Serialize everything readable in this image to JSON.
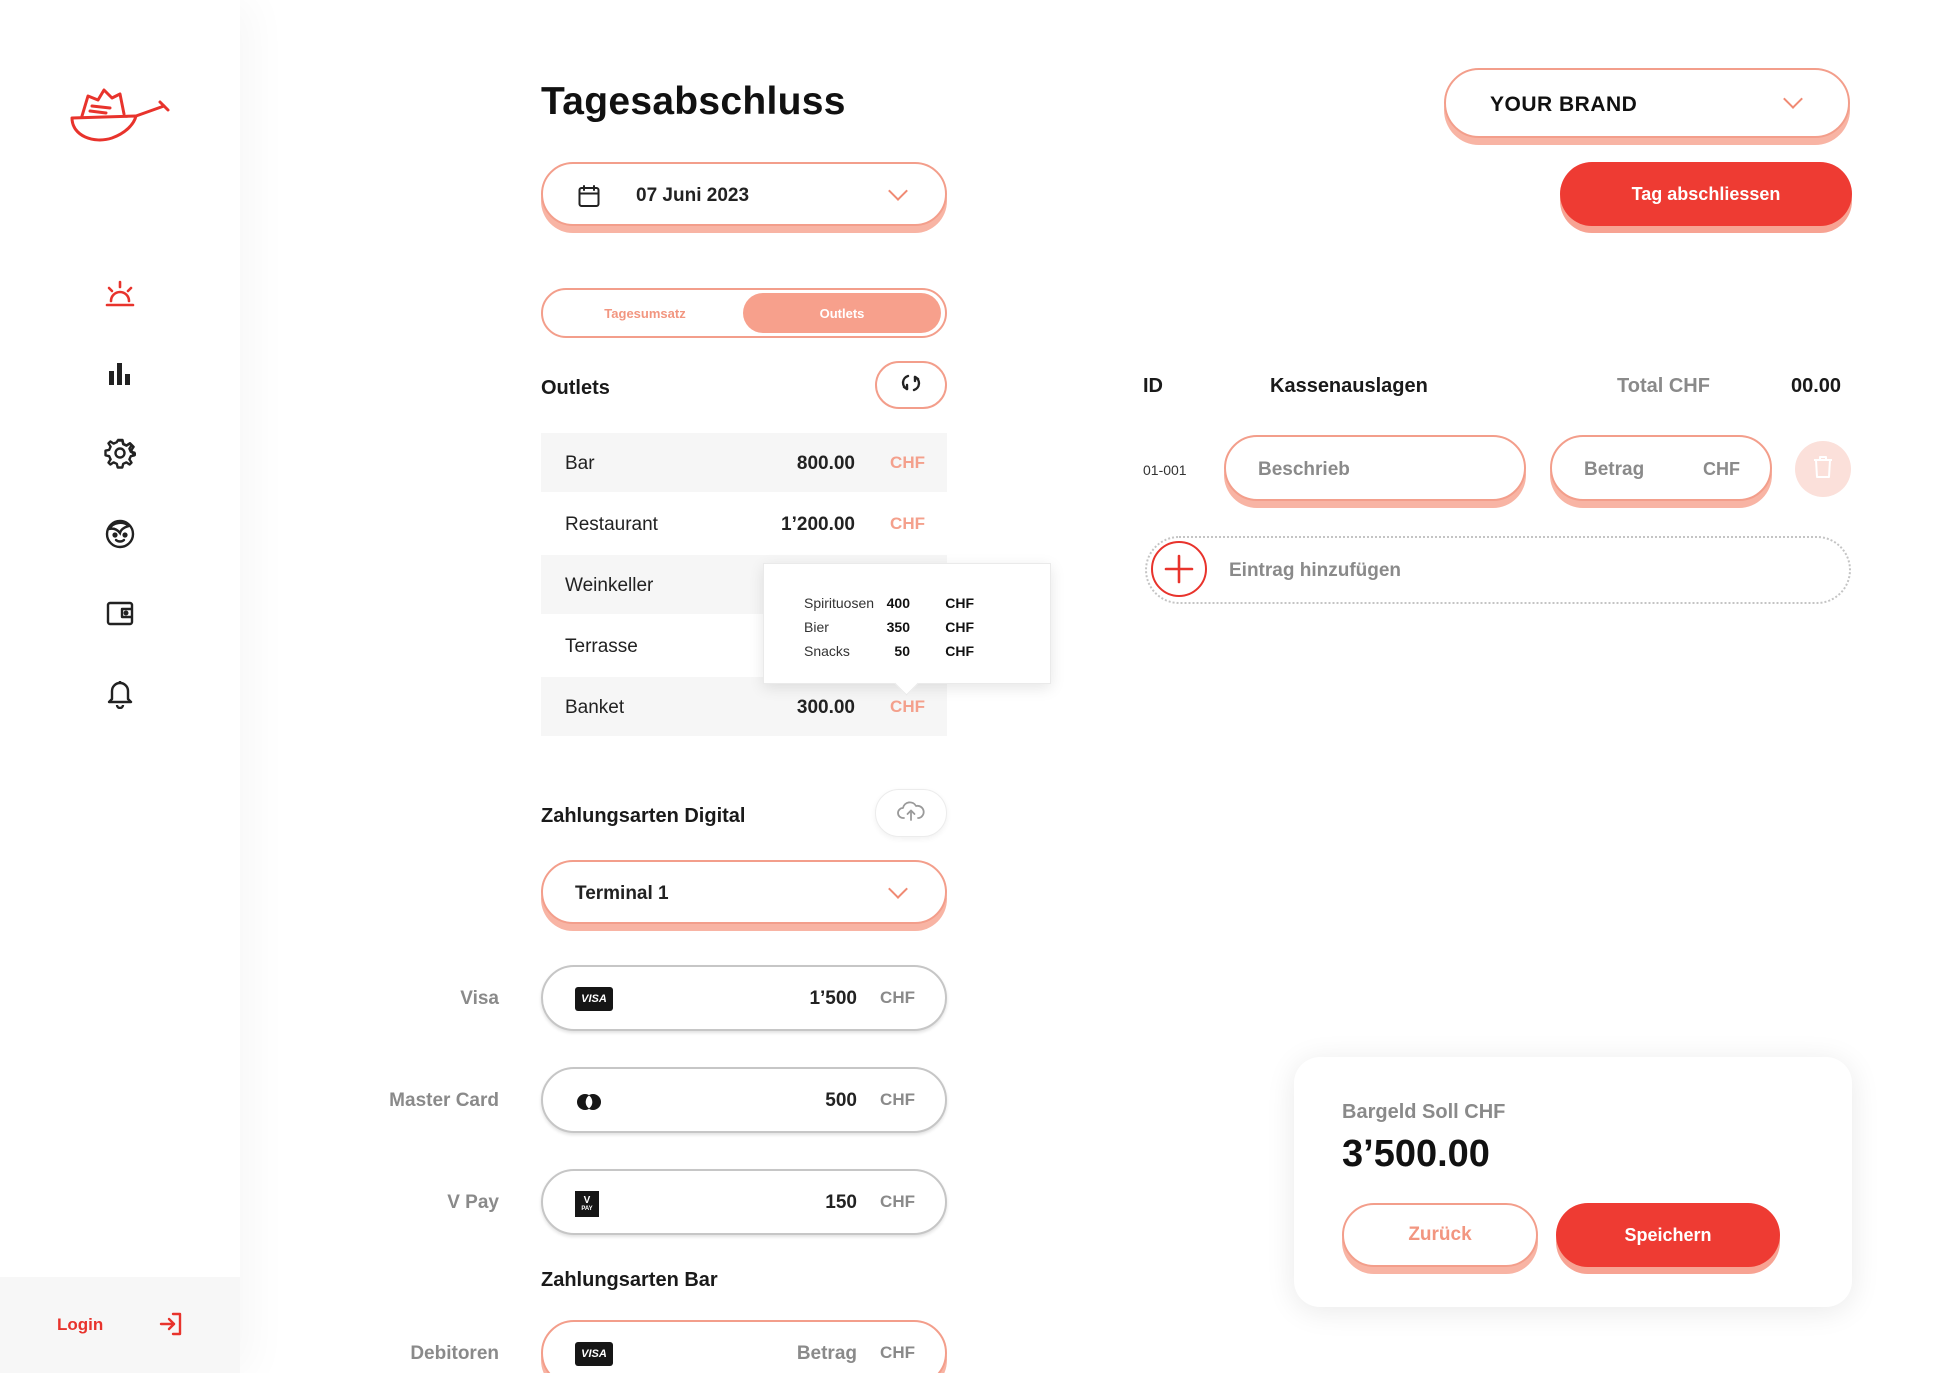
{
  "sidebar": {
    "nav": [
      {
        "id": "dashboard",
        "icon": "sunrise-icon",
        "active": true
      },
      {
        "id": "statistics",
        "icon": "bar-chart-icon",
        "active": false
      },
      {
        "id": "settings",
        "icon": "gear-icon",
        "active": false
      },
      {
        "id": "profile",
        "icon": "face-icon",
        "active": false
      },
      {
        "id": "wallet",
        "icon": "wallet-icon",
        "active": false
      },
      {
        "id": "notifications",
        "icon": "bell-icon",
        "active": false
      }
    ],
    "login_label": "Login"
  },
  "page": {
    "title": "Tagesabschluss",
    "date": "07 Juni 2023",
    "tabs": [
      {
        "label": "Tagesumsatz",
        "active": false
      },
      {
        "label": "Outlets",
        "active": true
      }
    ]
  },
  "outlets": {
    "heading": "Outlets",
    "rows": [
      {
        "name": "Bar",
        "value": "800.00",
        "currency": "CHF"
      },
      {
        "name": "Restaurant",
        "value": "1’200.00",
        "currency": "CHF"
      },
      {
        "name": "Weinkeller",
        "value": "",
        "currency": ""
      },
      {
        "name": "Terrasse",
        "value": "",
        "currency": ""
      },
      {
        "name": "Banket",
        "value": "300.00",
        "currency": "CHF"
      }
    ],
    "tooltip": [
      {
        "name": "Spirituosen",
        "value": "400",
        "currency": "CHF"
      },
      {
        "name": "Bier",
        "value": "350",
        "currency": "CHF"
      },
      {
        "name": "Snacks",
        "value": "50",
        "currency": "CHF"
      }
    ]
  },
  "digital": {
    "heading": "Zahlungsarten Digital",
    "terminal": "Terminal 1",
    "methods": [
      {
        "label": "Visa",
        "badge": "VISA",
        "value": "1’500",
        "currency": "CHF"
      },
      {
        "label": "Master Card",
        "badge": "",
        "value": "500",
        "currency": "CHF"
      },
      {
        "label": "V Pay",
        "badge": "V",
        "badge_sub": "PAY",
        "value": "150",
        "currency": "CHF"
      }
    ]
  },
  "bar": {
    "heading": "Zahlungsarten Bar",
    "rows": [
      {
        "label": "Debitoren",
        "badge": "VISA",
        "placeholder": "Betrag",
        "currency": "CHF"
      }
    ]
  },
  "header": {
    "brand": "YOUR BRAND",
    "close_day_button": "Tag abschliessen"
  },
  "kassen": {
    "col_id": "ID",
    "col_title": "Kassenauslagen",
    "total_label": "Total CHF",
    "total_value": "00.00",
    "entry_id": "01-001",
    "description_placeholder": "Beschrieb",
    "amount_placeholder": "Betrag",
    "amount_currency": "CHF",
    "add_entry": "Eintrag hinzufügen"
  },
  "cash": {
    "label": "Bargeld Soll CHF",
    "amount": "3’500.00",
    "back_button": "Zurück",
    "save_button": "Speichern"
  },
  "colors": {
    "accent": "#ee3b33",
    "accent_soft": "#f39e8b",
    "muted": "#8a8a8a"
  }
}
